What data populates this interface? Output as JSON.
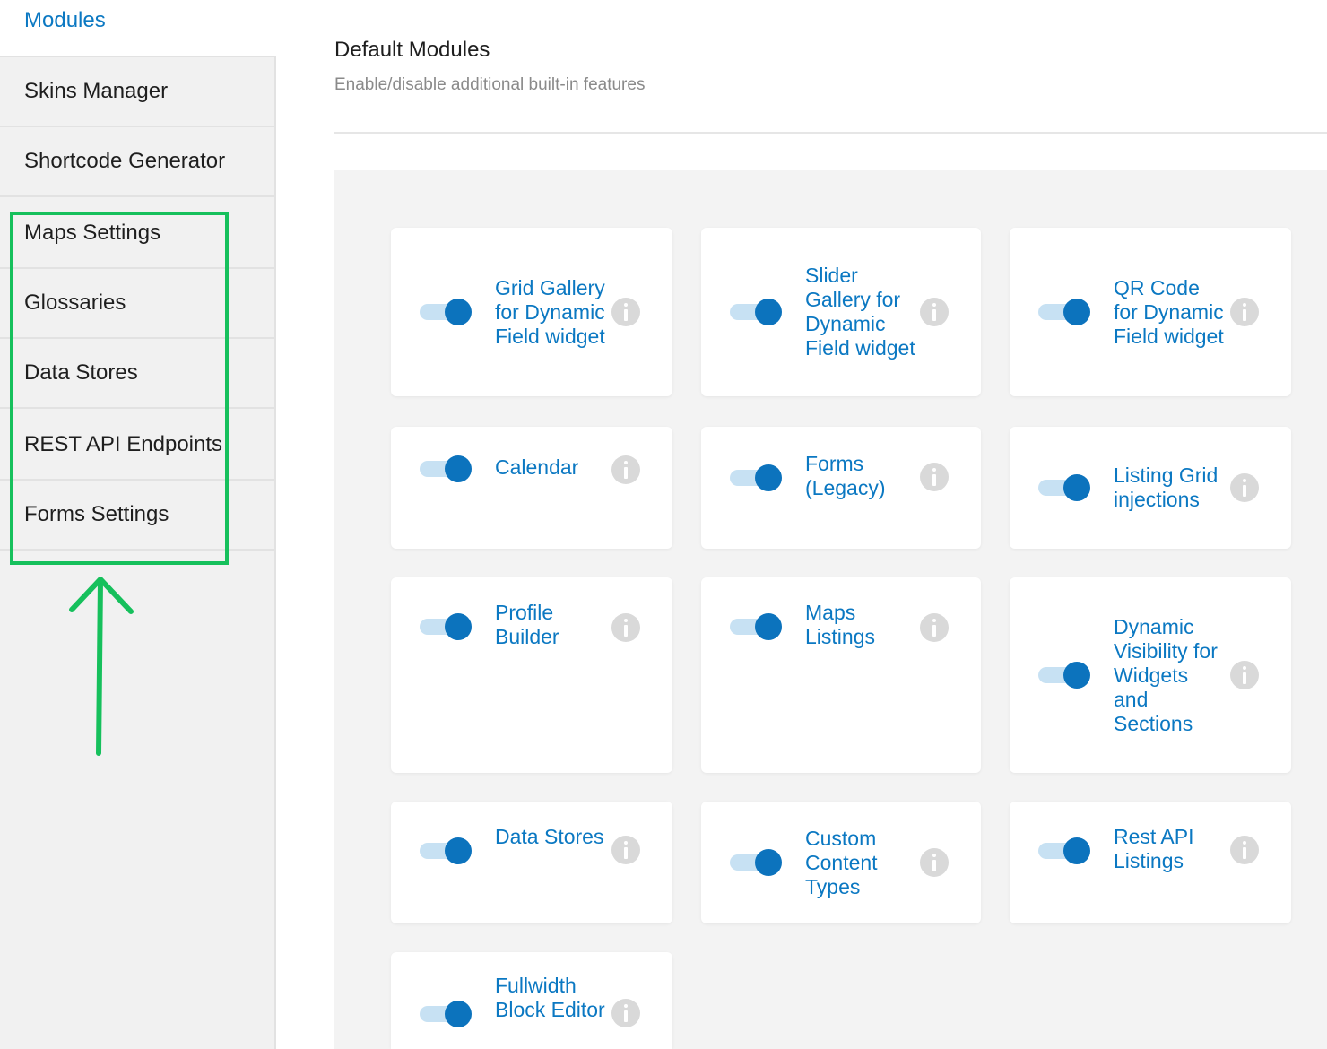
{
  "sidebar": {
    "active_label": "Modules",
    "items": [
      {
        "id": "skins-manager",
        "label": "Skins Manager"
      },
      {
        "id": "shortcode-generator",
        "label": "Shortcode Generator"
      },
      {
        "id": "maps-settings",
        "label": "Maps Settings"
      },
      {
        "id": "glossaries",
        "label": "Glossaries"
      },
      {
        "id": "data-stores",
        "label": "Data Stores"
      },
      {
        "id": "rest-api-endpoints",
        "label": "REST API Endpoints"
      },
      {
        "id": "forms-settings",
        "label": "Forms Settings"
      }
    ]
  },
  "annotation": {
    "color": "#16c05c"
  },
  "main": {
    "title": "Default Modules",
    "subtitle": "Enable/disable additional built-in features"
  },
  "modules": [
    {
      "label": "Grid Gallery for Dynamic Field widget",
      "enabled": true
    },
    {
      "label": "Slider Gallery for Dynamic Field widget",
      "enabled": true
    },
    {
      "label": "QR Code for Dynamic Field widget",
      "enabled": true
    },
    {
      "label": "Calendar",
      "enabled": true
    },
    {
      "label": "Forms (Legacy)",
      "enabled": true
    },
    {
      "label": "Listing Grid injections",
      "enabled": true
    },
    {
      "label": "Profile Builder",
      "enabled": true
    },
    {
      "label": "Maps Listings",
      "enabled": true
    },
    {
      "label": "Dynamic Visibility for Widgets and Sections",
      "enabled": true
    },
    {
      "label": "Data Stores",
      "enabled": true
    },
    {
      "label": "Custom Content Types",
      "enabled": true
    },
    {
      "label": "Rest API Listings",
      "enabled": true
    },
    {
      "label": "Fullwidth Block Editor",
      "enabled": true
    }
  ],
  "colors": {
    "accent": "#0b78c2",
    "toggle_knob": "#0c73bd",
    "toggle_track": "#c7e1f3"
  }
}
